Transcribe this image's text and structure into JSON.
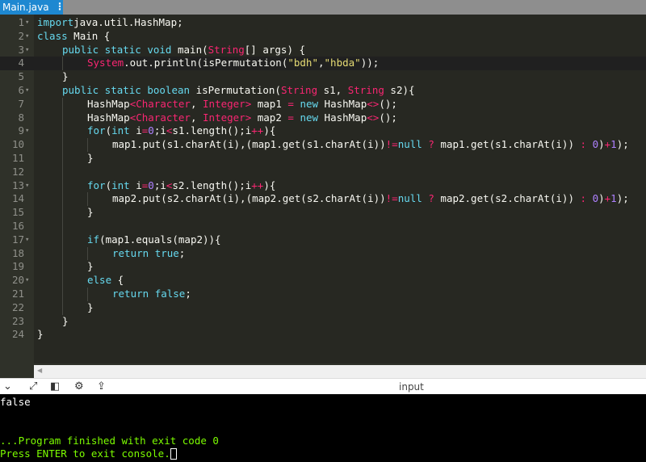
{
  "tab": {
    "filename": "Main.java",
    "menu_glyph": "⋮"
  },
  "editor": {
    "lines": [
      {
        "n": "1",
        "fold": "▾",
        "indent": 0,
        "tokens": [
          [
            "kw",
            "import"
          ],
          [
            "",
            "java.util.HashMap;"
          ]
        ]
      },
      {
        "n": "2",
        "fold": "▾",
        "indent": 0,
        "tokens": [
          [
            "kw",
            "class"
          ],
          [
            "",
            " Main {"
          ]
        ]
      },
      {
        "n": "3",
        "fold": "▾",
        "indent": 1,
        "tokens": [
          [
            "kw",
            "public static void"
          ],
          [
            "",
            " main("
          ],
          [
            "ty",
            "String"
          ],
          [
            "",
            "[] args) {"
          ]
        ]
      },
      {
        "n": "4",
        "fold": "",
        "indent": 2,
        "active": true,
        "tokens": [
          [
            "ty",
            "System"
          ],
          [
            "",
            ".out.println(isPermutation("
          ],
          [
            "st",
            "\"bdh\""
          ],
          [
            "",
            ","
          ],
          [
            "st",
            "\"hbda\""
          ],
          [
            "",
            "));"
          ]
        ]
      },
      {
        "n": "5",
        "fold": "",
        "indent": 1,
        "tokens": [
          [
            "",
            "}"
          ]
        ]
      },
      {
        "n": "6",
        "fold": "▾",
        "indent": 1,
        "tokens": [
          [
            "kw",
            "public static boolean"
          ],
          [
            "",
            " isPermutation("
          ],
          [
            "ty",
            "String"
          ],
          [
            "",
            " s1, "
          ],
          [
            "ty",
            "String"
          ],
          [
            "",
            " s2){"
          ]
        ]
      },
      {
        "n": "7",
        "fold": "",
        "indent": 2,
        "tokens": [
          [
            "",
            "HashMap"
          ],
          [
            "op",
            "<"
          ],
          [
            "ty",
            "Character"
          ],
          [
            "",
            ", "
          ],
          [
            "ty",
            "Integer"
          ],
          [
            "op",
            ">"
          ],
          [
            "",
            " map1 "
          ],
          [
            "op",
            "="
          ],
          [
            "",
            " "
          ],
          [
            "kw",
            "new"
          ],
          [
            "",
            " HashMap"
          ],
          [
            "op",
            "<>"
          ],
          [
            "",
            "();"
          ]
        ]
      },
      {
        "n": "8",
        "fold": "",
        "indent": 2,
        "tokens": [
          [
            "",
            "HashMap"
          ],
          [
            "op",
            "<"
          ],
          [
            "ty",
            "Character"
          ],
          [
            "",
            ", "
          ],
          [
            "ty",
            "Integer"
          ],
          [
            "op",
            ">"
          ],
          [
            "",
            " map2 "
          ],
          [
            "op",
            "="
          ],
          [
            "",
            " "
          ],
          [
            "kw",
            "new"
          ],
          [
            "",
            " HashMap"
          ],
          [
            "op",
            "<>"
          ],
          [
            "",
            "();"
          ]
        ]
      },
      {
        "n": "9",
        "fold": "▾",
        "indent": 2,
        "tokens": [
          [
            "kw",
            "for"
          ],
          [
            "",
            "("
          ],
          [
            "kw",
            "int"
          ],
          [
            "",
            " i"
          ],
          [
            "op",
            "="
          ],
          [
            "nm",
            "0"
          ],
          [
            "",
            ";i"
          ],
          [
            "op",
            "<"
          ],
          [
            "",
            "s1.length();i"
          ],
          [
            "op",
            "++"
          ],
          [
            "",
            "){"
          ]
        ]
      },
      {
        "n": "10",
        "fold": "",
        "indent": 3,
        "tokens": [
          [
            "",
            "map1.put(s1.charAt(i),(map1.get(s1.charAt(i))"
          ],
          [
            "op",
            "!="
          ],
          [
            "kw",
            "null"
          ],
          [
            "",
            " "
          ],
          [
            "op",
            "?"
          ],
          [
            "",
            " map1.get(s1.charAt(i)) "
          ],
          [
            "op",
            ":"
          ],
          [
            "",
            " "
          ],
          [
            "nm",
            "0"
          ],
          [
            "",
            ")"
          ],
          [
            "op",
            "+"
          ],
          [
            "nm",
            "1"
          ],
          [
            "",
            ");"
          ]
        ]
      },
      {
        "n": "11",
        "fold": "",
        "indent": 2,
        "tokens": [
          [
            "",
            "}"
          ]
        ]
      },
      {
        "n": "12",
        "fold": "",
        "indent": 2,
        "tokens": []
      },
      {
        "n": "13",
        "fold": "▾",
        "indent": 2,
        "tokens": [
          [
            "kw",
            "for"
          ],
          [
            "",
            "("
          ],
          [
            "kw",
            "int"
          ],
          [
            "",
            " i"
          ],
          [
            "op",
            "="
          ],
          [
            "nm",
            "0"
          ],
          [
            "",
            ";i"
          ],
          [
            "op",
            "<"
          ],
          [
            "",
            "s2.length();i"
          ],
          [
            "op",
            "++"
          ],
          [
            "",
            "){"
          ]
        ]
      },
      {
        "n": "14",
        "fold": "",
        "indent": 3,
        "tokens": [
          [
            "",
            "map2.put(s2.charAt(i),(map2.get(s2.charAt(i))"
          ],
          [
            "op",
            "!="
          ],
          [
            "kw",
            "null"
          ],
          [
            "",
            " "
          ],
          [
            "op",
            "?"
          ],
          [
            "",
            " map2.get(s2.charAt(i)) "
          ],
          [
            "op",
            ":"
          ],
          [
            "",
            " "
          ],
          [
            "nm",
            "0"
          ],
          [
            "",
            ")"
          ],
          [
            "op",
            "+"
          ],
          [
            "nm",
            "1"
          ],
          [
            "",
            ");"
          ]
        ]
      },
      {
        "n": "15",
        "fold": "",
        "indent": 2,
        "tokens": [
          [
            "",
            "}"
          ]
        ]
      },
      {
        "n": "16",
        "fold": "",
        "indent": 2,
        "tokens": []
      },
      {
        "n": "17",
        "fold": "▾",
        "indent": 2,
        "tokens": [
          [
            "kw",
            "if"
          ],
          [
            "",
            "(map1.equals(map2)){"
          ]
        ]
      },
      {
        "n": "18",
        "fold": "",
        "indent": 3,
        "tokens": [
          [
            "kw",
            "return"
          ],
          [
            "",
            " "
          ],
          [
            "kw",
            "true"
          ],
          [
            "",
            ";"
          ]
        ]
      },
      {
        "n": "19",
        "fold": "",
        "indent": 2,
        "tokens": [
          [
            "",
            "}"
          ]
        ]
      },
      {
        "n": "20",
        "fold": "▾",
        "indent": 2,
        "tokens": [
          [
            "kw",
            "else"
          ],
          [
            "",
            " {"
          ]
        ]
      },
      {
        "n": "21",
        "fold": "",
        "indent": 3,
        "tokens": [
          [
            "kw",
            "return"
          ],
          [
            "",
            " "
          ],
          [
            "kw",
            "false"
          ],
          [
            "",
            ";"
          ]
        ]
      },
      {
        "n": "22",
        "fold": "",
        "indent": 2,
        "tokens": [
          [
            "",
            "}"
          ]
        ]
      },
      {
        "n": "23",
        "fold": "",
        "indent": 1,
        "tokens": [
          [
            "",
            "}"
          ]
        ]
      },
      {
        "n": "24",
        "fold": "",
        "indent": 0,
        "tokens": [
          [
            "",
            "}"
          ]
        ]
      }
    ]
  },
  "toolbar": {
    "collapse_icon": "chevron-down-icon",
    "expand_icon": "expand-icon",
    "layout_icon": "layout-icon",
    "settings_icon": "gear-icon",
    "share_icon": "share-icon",
    "input_label": "input"
  },
  "console": {
    "output": "false",
    "finished": "...Program finished with exit code 0",
    "prompt": "Press ENTER to exit console."
  },
  "colors": {
    "tab": "#1e88d1",
    "editor_bg": "#272822",
    "console_text_green": "#7cfc00"
  }
}
